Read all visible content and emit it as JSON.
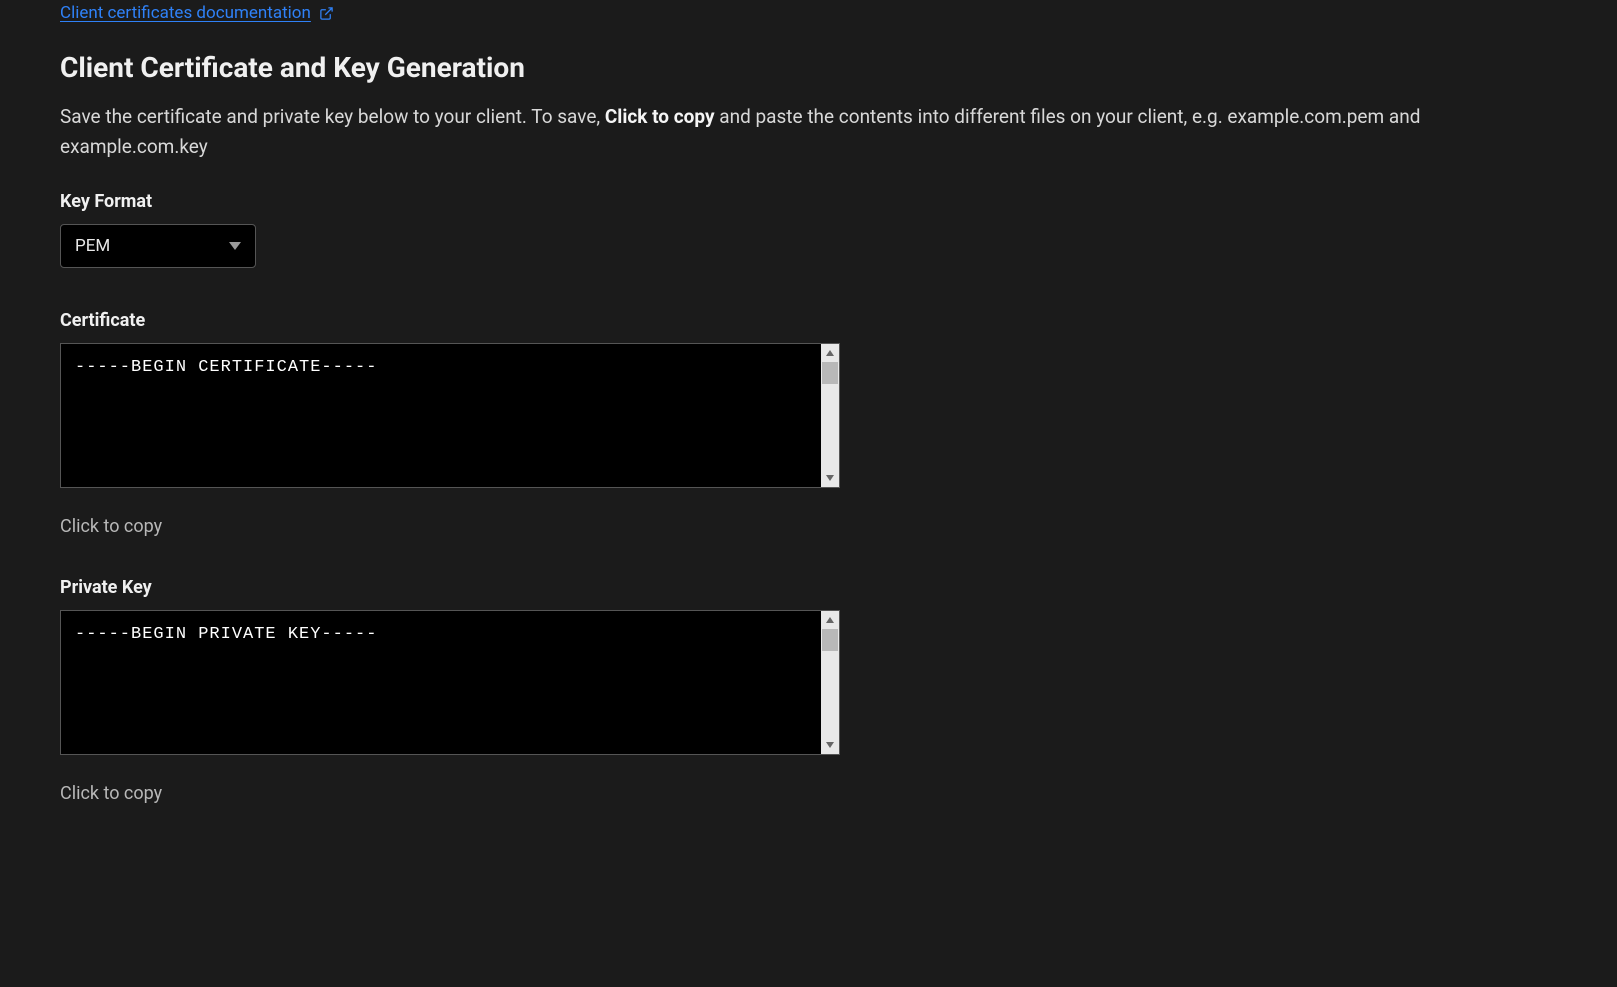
{
  "docLink": {
    "text": "Client certificates documentation"
  },
  "pageTitle": "Client Certificate and Key Generation",
  "description": {
    "prefix": "Save the certificate and private key below to your client. To save, ",
    "bold": "Click to copy",
    "suffix": " and paste the contents into different files on your client, e.g. example.com.pem and example.com.key"
  },
  "keyFormat": {
    "label": "Key Format",
    "value": "PEM"
  },
  "certificate": {
    "label": "Certificate",
    "content": "-----BEGIN CERTIFICATE-----",
    "copyText": "Click to copy"
  },
  "privateKey": {
    "label": "Private Key",
    "content": "-----BEGIN PRIVATE KEY-----",
    "copyText": "Click to copy"
  }
}
